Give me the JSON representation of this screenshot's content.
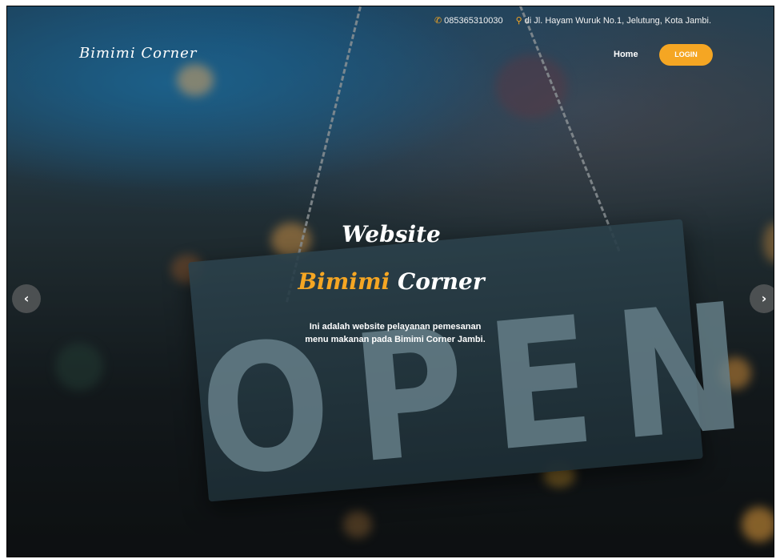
{
  "topbar": {
    "phone": "085365310030",
    "address": "di Jl. Hayam Wuruk No.1, Jelutung, Kota Jambi."
  },
  "nav": {
    "brand": "Bimimi Corner",
    "home": "Home",
    "login": "LOGIN"
  },
  "hero": {
    "title_line1": "Website",
    "title_accent": "Bimimi",
    "title_rest": "Corner",
    "description": "Ini adalah website pelayanan pemesanan menu makanan pada Bimimi Corner Jambi.",
    "sign_text": "OPEN"
  },
  "carousel": {
    "prev_icon": "‹",
    "next_icon": "›"
  },
  "colors": {
    "accent": "#f5a623"
  }
}
